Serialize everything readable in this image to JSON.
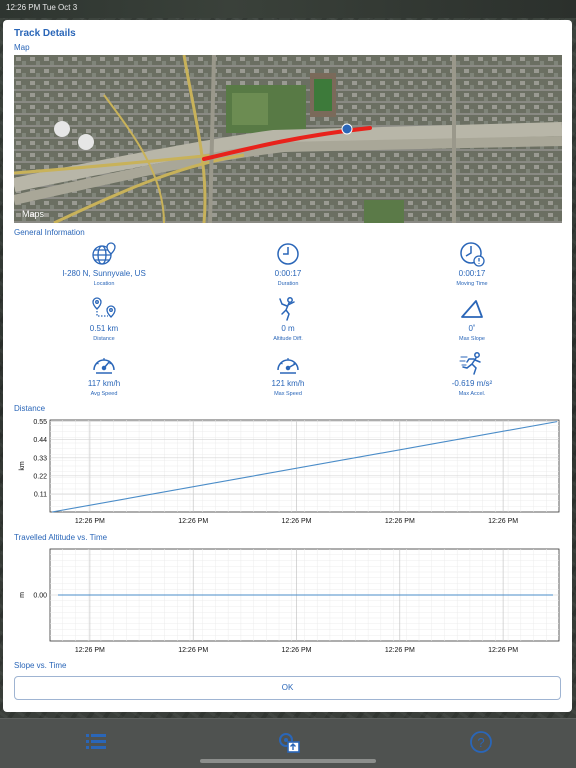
{
  "status_bar": {
    "text": "12:26 PM  Tue Oct 3"
  },
  "dialog": {
    "title": "Track Details",
    "ok_label": "OK"
  },
  "sections": {
    "map": "Map",
    "general": "General Information",
    "distance": "Distance",
    "altitude": "Travelled Altitude vs. Time",
    "slope": "Slope vs. Time"
  },
  "map": {
    "attribution": "Maps",
    "route_color": "#e8221b"
  },
  "info": [
    {
      "icon": "globe-pin-icon",
      "value": "I-280 N, Sunnyvale, US",
      "label": "Location"
    },
    {
      "icon": "clock-icon",
      "value": "0:00:17",
      "label": "Duration"
    },
    {
      "icon": "clock-alert-icon",
      "value": "0:00:17",
      "label": "Moving Time"
    },
    {
      "icon": "distance-pins-icon",
      "value": "0.51 km",
      "label": "Distance"
    },
    {
      "icon": "climber-icon",
      "value": "0 m",
      "label": "Altitude Diff."
    },
    {
      "icon": "slope-triangle-icon",
      "value": "0˚",
      "label": "Max Slope"
    },
    {
      "icon": "speedometer-icon",
      "value": "117 km/h",
      "label": "Avg Speed"
    },
    {
      "icon": "speedometer-max-icon",
      "value": "121 km/h",
      "label": "Max Speed"
    },
    {
      "icon": "runner-accel-icon",
      "value": "-0.619 m/s²",
      "label": "Max Accel."
    }
  ],
  "colors": {
    "accent": "#2a66b8",
    "line": "#4a8cc8"
  },
  "chart_data": [
    {
      "type": "line",
      "title": "Distance",
      "ylabel": "km",
      "x_ticks": [
        "12:26 PM",
        "12:26 PM",
        "12:26 PM",
        "12:26 PM",
        "12:26 PM"
      ],
      "y_ticks": [
        "0.11",
        "0.22",
        "0.33",
        "0.44",
        "0.55"
      ],
      "ylim": [
        0.0,
        0.56
      ],
      "grid": true,
      "series": [
        {
          "x": [
            0,
            1
          ],
          "values": [
            0.0,
            0.55
          ]
        }
      ]
    },
    {
      "type": "line",
      "title": "Travelled Altitude vs. Time",
      "ylabel": "m",
      "x_ticks": [
        "12:26 PM",
        "12:26 PM",
        "12:26 PM",
        "12:26 PM",
        "12:26 PM"
      ],
      "y_ticks": [
        "0.00"
      ],
      "ylim": [
        -1,
        1
      ],
      "grid": true,
      "series": [
        {
          "x": [
            0,
            1
          ],
          "values": [
            0.0,
            0.0
          ]
        }
      ]
    }
  ],
  "toolbar": {
    "icons": [
      "list-icon",
      "settings-export-icon",
      "help-icon"
    ]
  }
}
